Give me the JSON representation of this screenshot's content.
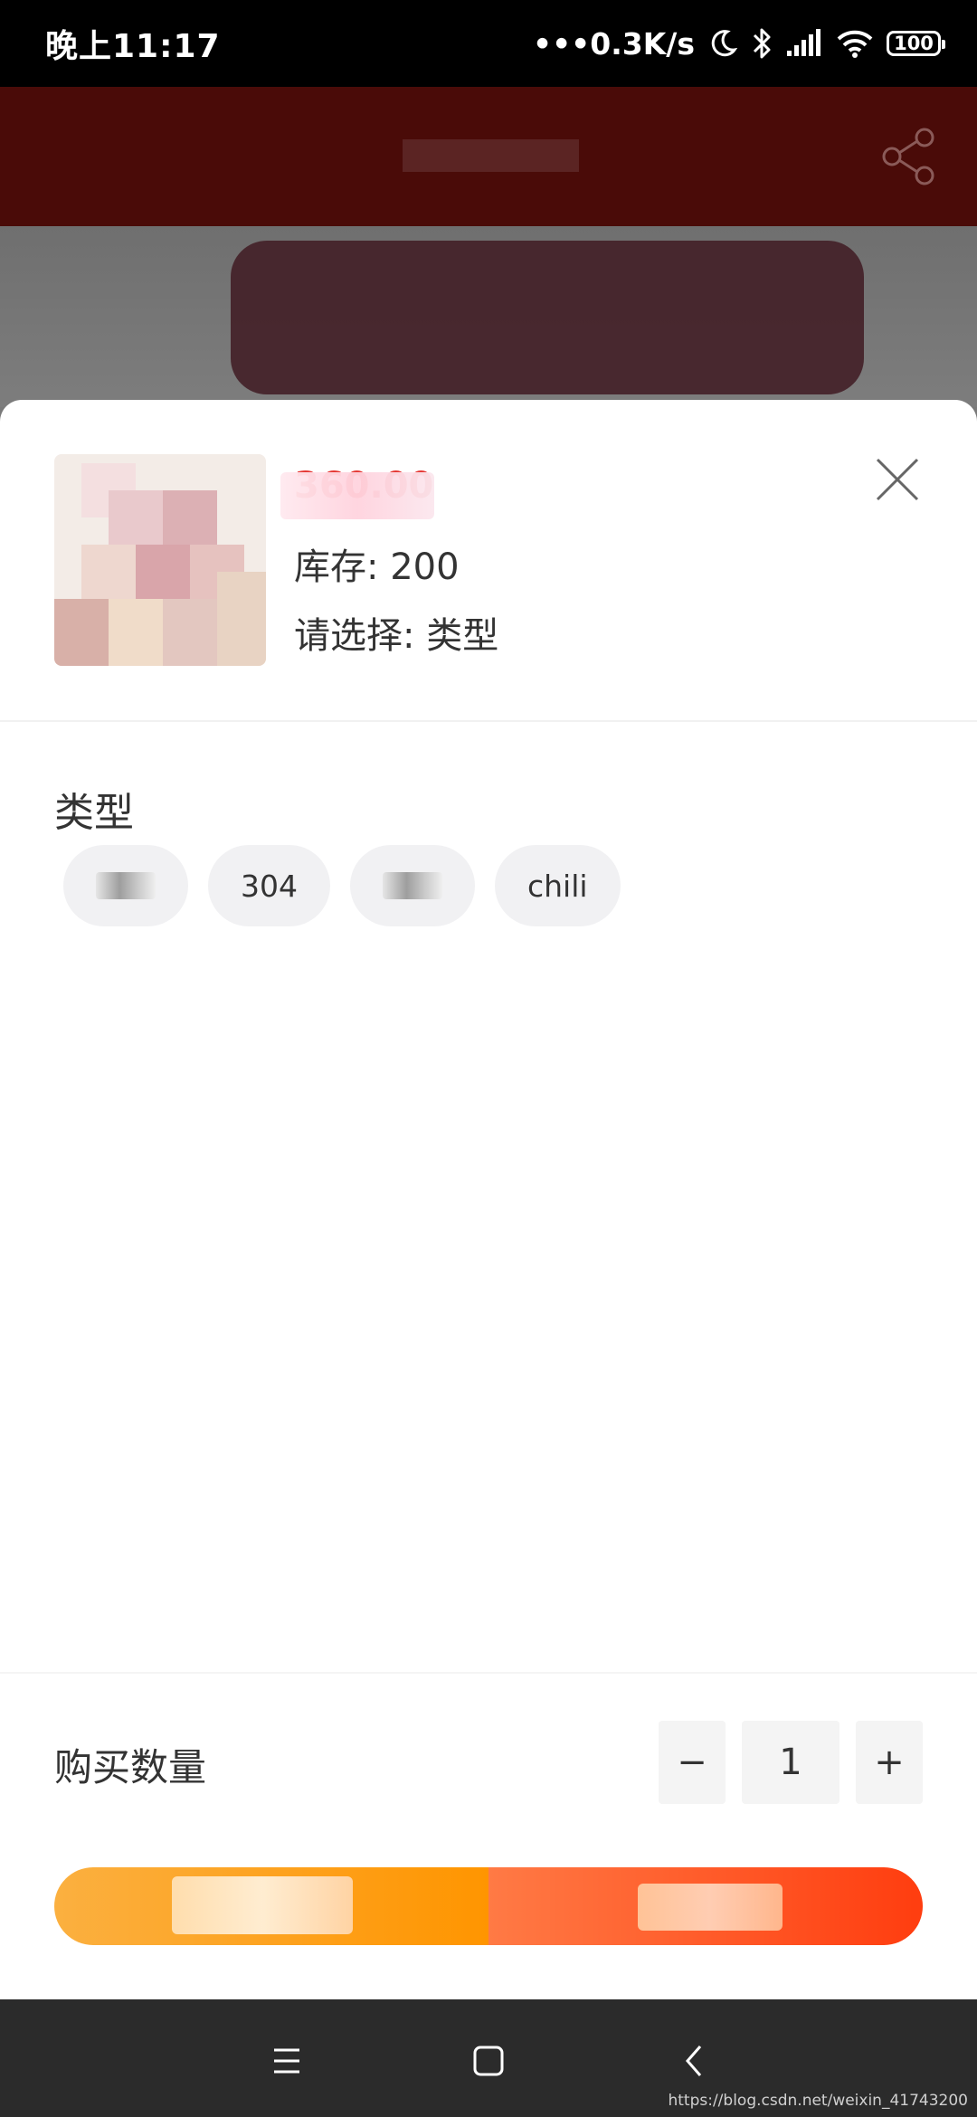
{
  "status_bar": {
    "time": "晚上11:17",
    "net_speed": "0.3K/s",
    "battery": "100"
  },
  "sheet": {
    "price": "360.00",
    "stock_text": "库存: 200",
    "select_text": "请选择: 类型",
    "section_title": "类型",
    "chips": [
      {
        "label": ""
      },
      {
        "label": "304"
      },
      {
        "label": ""
      },
      {
        "label": "chili"
      }
    ],
    "quantity_label": "购买数量",
    "quantity_value": "1",
    "minus_label": "−",
    "plus_label": "+"
  },
  "nav": {
    "watermark": "https://blog.csdn.net/weixin_41743200"
  },
  "colors": {
    "price": "#e53935",
    "cart_button_start": "#fbb040",
    "cart_button_end": "#ff9500",
    "buy_button_start": "#ff7a45",
    "buy_button_end": "#ff3d0f",
    "chip_bg": "#f1f1f3"
  }
}
